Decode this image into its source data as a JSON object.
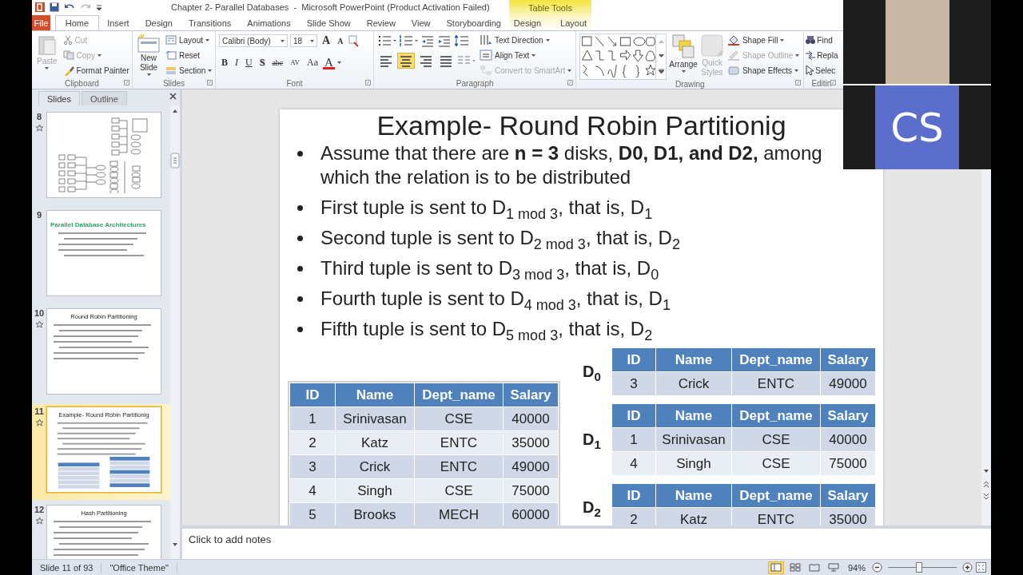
{
  "window": {
    "title": "Chapter 2- Parallel Databases  -  Microsoft PowerPoint (Product Activation Failed)",
    "contextual": {
      "label": "Table Tools",
      "tabs": [
        {
          "label": "Design",
          "selected": false
        },
        {
          "label": "Layout",
          "selected": false
        }
      ]
    }
  },
  "tabs": [
    {
      "label": "File",
      "kind": "file",
      "selected": false
    },
    {
      "label": "Home",
      "kind": "tab",
      "selected": true
    },
    {
      "label": "Insert",
      "kind": "tab",
      "selected": false
    },
    {
      "label": "Design",
      "kind": "tab",
      "selected": false
    },
    {
      "label": "Transitions",
      "kind": "tab",
      "selected": false
    },
    {
      "label": "Animations",
      "kind": "tab",
      "selected": false
    },
    {
      "label": "Slide Show",
      "kind": "tab",
      "selected": false
    },
    {
      "label": "Review",
      "kind": "tab",
      "selected": false
    },
    {
      "label": "View",
      "kind": "tab",
      "selected": false
    },
    {
      "label": "Storyboarding",
      "kind": "tab",
      "selected": false
    }
  ],
  "ribbon": {
    "clipboard": {
      "label": "Clipboard",
      "paste": {
        "label": "Paste",
        "disabled": true
      },
      "cut": {
        "label": "Cut",
        "disabled": true
      },
      "copy": {
        "label": "Copy",
        "disabled": true
      },
      "format_painter": {
        "label": "Format Painter",
        "disabled": false
      }
    },
    "slides": {
      "label": "Slides",
      "new_slide": "New Slide",
      "layout": "Layout",
      "reset": "Reset",
      "section": "Section"
    },
    "font": {
      "label": "Font",
      "font_name": "Calibri (Body)",
      "font_size": "18",
      "grow": "A",
      "shrink": "A",
      "buttons": [
        {
          "label": "B",
          "kind": "bold"
        },
        {
          "label": "I",
          "kind": "italic"
        },
        {
          "label": "U",
          "kind": "underline"
        },
        {
          "label": "S",
          "kind": "shadow"
        },
        {
          "label": "abc",
          "kind": "strike"
        },
        {
          "label": "AV",
          "kind": "spacing"
        },
        {
          "label": "Aa",
          "kind": "case"
        }
      ],
      "font_color": "A"
    },
    "paragraph": {
      "label": "Paragraph",
      "alignment": [
        {
          "selected": false
        },
        {
          "selected": true
        },
        {
          "selected": false
        },
        {
          "selected": false
        }
      ],
      "text_direction": "Text Direction",
      "align_text": "Align Text",
      "convert_smartart": {
        "label": "Convert to SmartArt",
        "disabled": true
      }
    },
    "drawing": {
      "label": "Drawing",
      "arrange": "Arrange",
      "quick_styles": {
        "label": "Quick Styles",
        "disabled": true
      },
      "shape_fill": {
        "label": "Shape Fill",
        "disabled": false
      },
      "shape_outline": {
        "label": "Shape Outline",
        "disabled": true
      },
      "shape_effects": {
        "label": "Shape Effects",
        "disabled": false
      }
    },
    "editing": {
      "label": "Editin",
      "find": "Find",
      "replace": "Repla",
      "select": "Selec"
    }
  },
  "slides_panel": {
    "tabs": [
      {
        "label": "Slides",
        "selected": true
      },
      {
        "label": "Outline",
        "selected": false
      }
    ],
    "thumbnails": [
      {
        "number": "8",
        "kind": "diagram",
        "animated": true,
        "selected": false
      },
      {
        "number": "9",
        "kind": "banner",
        "title": "Parallel Database Architectures",
        "animated": false,
        "selected": false
      },
      {
        "number": "10",
        "kind": "centered",
        "title": "Round  Robin  Partitioning",
        "animated": true,
        "selected": false
      },
      {
        "number": "11",
        "kind": "tables",
        "title": "Example-  Round Robin Partitionig",
        "animated": true,
        "selected": true
      },
      {
        "number": "12",
        "kind": "centered",
        "title": "Hash Partitioning",
        "animated": true,
        "selected": false
      }
    ]
  },
  "slide": {
    "title": "Example- Round Robin Partitionig",
    "bullets": [
      "Assume that there are **n = 3** disks, **D0, D1, and D2,** among which the relation is to be distributed",
      "First tuple is sent to D$_{1 mod 3}$, that is, D$_{1}$",
      "Second tuple is sent to D$_{2 mod 3}$, that is, D$_{2}$",
      "Third tuple is sent to D$_{3 mod 3}$, that is, D$_{0}$",
      "Fourth tuple is sent to D$_{4 mod 3}$, that is, D$_{1}$",
      "Fifth tuple is sent to D$_{5 mod 3}$, that is, D$_{2}$"
    ],
    "relation_table": {
      "columns": [
        "ID",
        "Name",
        "Dept_name",
        "Salary"
      ],
      "rows": [
        [
          "1",
          "Srinivasan",
          "CSE",
          "40000"
        ],
        [
          "2",
          "Katz",
          "ENTC",
          "35000"
        ],
        [
          "3",
          "Crick",
          "ENTC",
          "49000"
        ],
        [
          "4",
          "Singh",
          "CSE",
          "75000"
        ],
        [
          "5",
          "Brooks",
          "MECH",
          "60000"
        ]
      ]
    },
    "disks": [
      {
        "label": "D$_{0}$",
        "columns": [
          "ID",
          "Name",
          "Dept_name",
          "Salary"
        ],
        "rows": [
          [
            "3",
            "Crick",
            "ENTC",
            "49000"
          ]
        ]
      },
      {
        "label": "D$_{1}$",
        "columns": [
          "ID",
          "Name",
          "Dept_name",
          "Salary"
        ],
        "rows": [
          [
            "1",
            "Srinivasan",
            "CSE",
            "40000"
          ],
          [
            "4",
            "Singh",
            "CSE",
            "75000"
          ]
        ]
      },
      {
        "label": "D$_{2}$",
        "columns": [
          "ID",
          "Name",
          "Dept_name",
          "Salary"
        ],
        "rows": [
          [
            "2",
            "Katz",
            "ENTC",
            "35000"
          ]
        ]
      }
    ]
  },
  "notes": {
    "placeholder": "Click to add notes"
  },
  "status_bar": {
    "slide": "Slide 11 of 93",
    "theme": "\"Office Theme\"",
    "views": [
      {
        "selected": true
      },
      {
        "selected": false
      },
      {
        "selected": false
      },
      {
        "selected": false
      }
    ],
    "zoom": "94%",
    "level": 0.45
  },
  "video": {
    "initials": "CS"
  }
}
